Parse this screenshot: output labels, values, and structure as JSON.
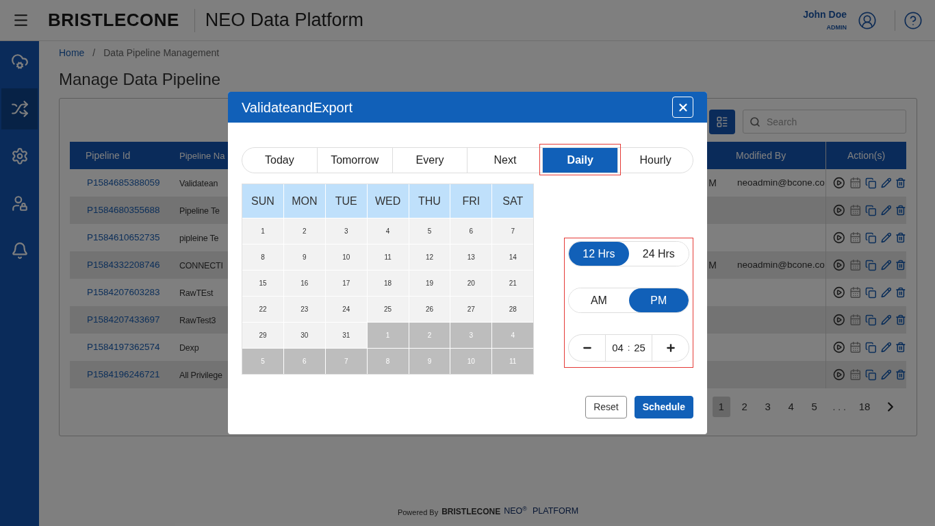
{
  "header": {
    "brand": "BRISTLECONE",
    "product": "NEO Data Platform",
    "user_name": "John Doe",
    "user_role": "ADMIN"
  },
  "sidebar": {
    "items": [
      {
        "selected": false
      },
      {
        "selected": true
      },
      {
        "selected": false
      },
      {
        "selected": false
      },
      {
        "selected": false
      }
    ]
  },
  "breadcrumb": {
    "separator": "/",
    "items": [
      {
        "label": "Home",
        "kind": "link"
      },
      {
        "label": "Data Pipeline Management",
        "kind": "current"
      }
    ]
  },
  "page_title": "Manage Data Pipeline",
  "toolbar": {
    "search_placeholder": "Search"
  },
  "table": {
    "columns": {
      "pipeline_id": "Pipeline Id",
      "pipeline_name": "Pipeline Na",
      "modified_by": "Modified By",
      "actions": "Action(s)"
    },
    "rows": [
      {
        "pipeline_id": "P1584685388059",
        "pipeline_name": "Validatean",
        "column_3": "M",
        "modified_by": "neoadmin@bcone.co"
      },
      {
        "pipeline_id": "P1584680355688",
        "pipeline_name": "Pipeline Te",
        "column_3": "",
        "modified_by": ""
      },
      {
        "pipeline_id": "P1584610652735",
        "pipeline_name": "pipleine Te",
        "column_3": "",
        "modified_by": ""
      },
      {
        "pipeline_id": "P1584332208746",
        "pipeline_name": "CONNECTI",
        "column_3": "M",
        "modified_by": "neoadmin@bcone.co"
      },
      {
        "pipeline_id": "P1584207603283",
        "pipeline_name": "RawTEst",
        "column_3": "",
        "modified_by": ""
      },
      {
        "pipeline_id": "P1584207433697",
        "pipeline_name": "RawTest3",
        "column_3": "",
        "modified_by": ""
      },
      {
        "pipeline_id": "P1584197362574",
        "pipeline_name": "Dexp",
        "column_3": "",
        "modified_by": ""
      },
      {
        "pipeline_id": "P1584196246721",
        "pipeline_name": "All Privilege",
        "column_3": "",
        "modified_by": ""
      }
    ]
  },
  "pagination": {
    "pages": [
      {
        "label": "1",
        "kind": "page",
        "selected": true
      },
      {
        "label": "2",
        "kind": "page",
        "selected": false
      },
      {
        "label": "3",
        "kind": "page",
        "selected": false
      },
      {
        "label": "4",
        "kind": "page",
        "selected": false
      },
      {
        "label": "5",
        "kind": "page",
        "selected": false
      },
      {
        "label": ". . .",
        "kind": "ellipsis",
        "selected": false
      },
      {
        "label": "18",
        "kind": "page",
        "selected": false
      }
    ]
  },
  "footer": {
    "prefix": "Powered By",
    "brand": "BRISTLECONE",
    "product": "NEO",
    "mark": "®",
    "suffix": "PLATFORM"
  },
  "modal": {
    "title": "ValidateandExport",
    "tabs": [
      {
        "label": "Today",
        "selected": false,
        "highlighted": false
      },
      {
        "label": "Tomorrow",
        "selected": false,
        "highlighted": false
      },
      {
        "label": "Every",
        "selected": false,
        "highlighted": false
      },
      {
        "label": "Next",
        "selected": false,
        "highlighted": false
      },
      {
        "label": "Daily",
        "selected": true,
        "highlighted": true
      },
      {
        "label": "Hourly",
        "selected": false,
        "highlighted": false
      }
    ],
    "calendar": {
      "weekdays": [
        "SUN",
        "MON",
        "TUE",
        "WED",
        "THU",
        "FRI",
        "SAT"
      ],
      "days": [
        {
          "label": "1",
          "outside": false
        },
        {
          "label": "2",
          "outside": false
        },
        {
          "label": "3",
          "outside": false
        },
        {
          "label": "4",
          "outside": false
        },
        {
          "label": "5",
          "outside": false
        },
        {
          "label": "6",
          "outside": false
        },
        {
          "label": "7",
          "outside": false
        },
        {
          "label": "8",
          "outside": false
        },
        {
          "label": "9",
          "outside": false
        },
        {
          "label": "10",
          "outside": false
        },
        {
          "label": "11",
          "outside": false
        },
        {
          "label": "12",
          "outside": false
        },
        {
          "label": "13",
          "outside": false
        },
        {
          "label": "14",
          "outside": false
        },
        {
          "label": "15",
          "outside": false
        },
        {
          "label": "16",
          "outside": false
        },
        {
          "label": "17",
          "outside": false
        },
        {
          "label": "18",
          "outside": false
        },
        {
          "label": "19",
          "outside": false
        },
        {
          "label": "20",
          "outside": false
        },
        {
          "label": "21",
          "outside": false
        },
        {
          "label": "22",
          "outside": false
        },
        {
          "label": "23",
          "outside": false
        },
        {
          "label": "24",
          "outside": false
        },
        {
          "label": "25",
          "outside": false
        },
        {
          "label": "26",
          "outside": false
        },
        {
          "label": "27",
          "outside": false
        },
        {
          "label": "28",
          "outside": false
        },
        {
          "label": "29",
          "outside": false
        },
        {
          "label": "30",
          "outside": false
        },
        {
          "label": "31",
          "outside": false
        },
        {
          "label": "1",
          "outside": true
        },
        {
          "label": "2",
          "outside": true
        },
        {
          "label": "3",
          "outside": true
        },
        {
          "label": "4",
          "outside": true
        },
        {
          "label": "5",
          "outside": true
        },
        {
          "label": "6",
          "outside": true
        },
        {
          "label": "7",
          "outside": true
        },
        {
          "label": "8",
          "outside": true
        },
        {
          "label": "9",
          "outside": true
        },
        {
          "label": "10",
          "outside": true
        },
        {
          "label": "11",
          "outside": true
        }
      ]
    },
    "time": {
      "highlighted": true,
      "formats": [
        {
          "label": "12 Hrs",
          "selected": true
        },
        {
          "label": "24 Hrs",
          "selected": false
        }
      ],
      "periods": [
        {
          "label": "AM",
          "selected": false
        },
        {
          "label": "PM",
          "selected": true
        }
      ],
      "hours": "04",
      "separator": ":",
      "minutes": "25"
    },
    "buttons": [
      {
        "label": "Reset",
        "kind": "secondary"
      },
      {
        "label": "Schedule",
        "kind": "primary"
      }
    ]
  }
}
